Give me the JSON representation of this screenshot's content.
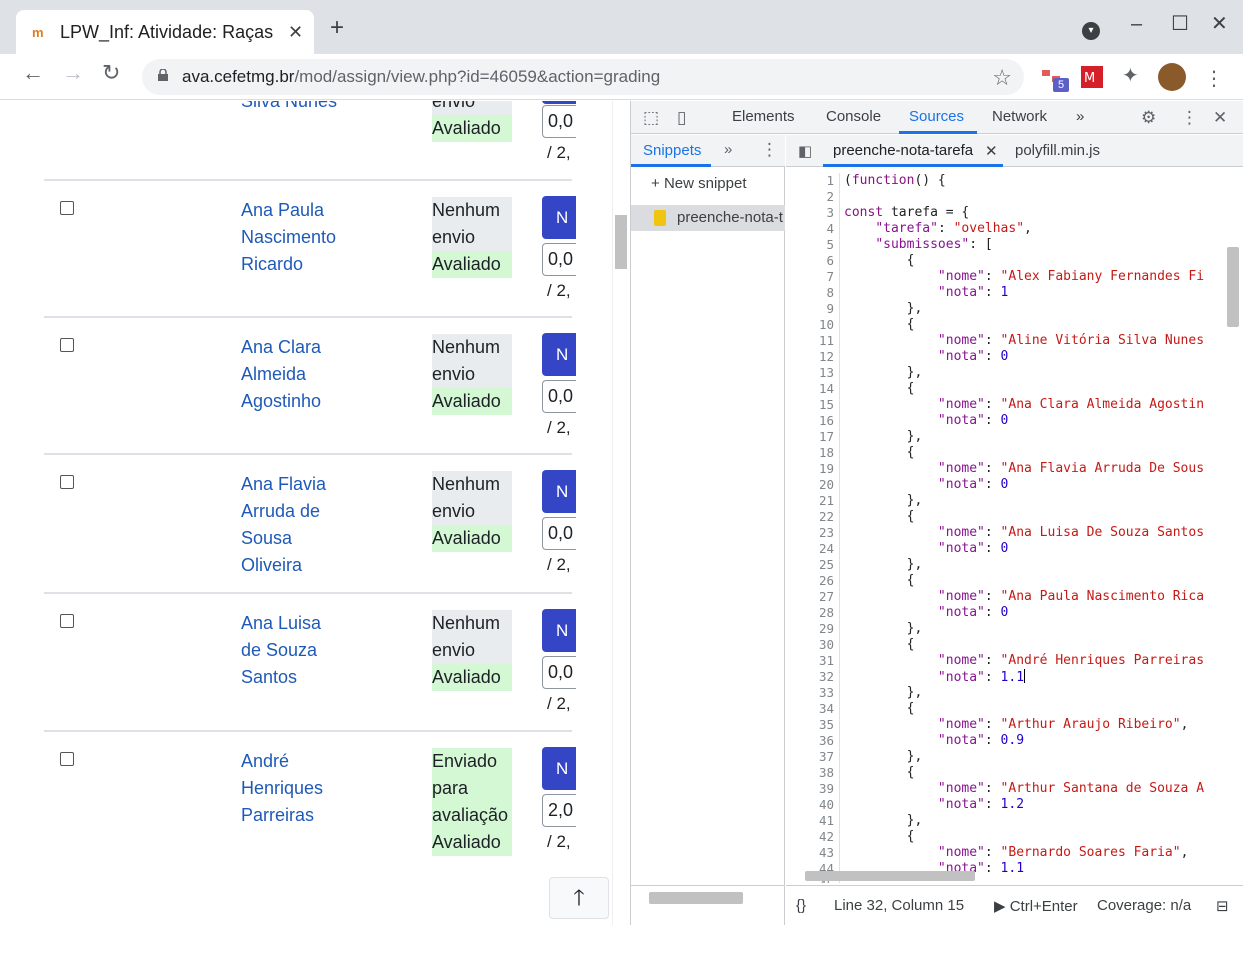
{
  "browser": {
    "tab_title": "LPW_Inf: Atividade: Raças",
    "new_tab": "+",
    "url_host": "ava.cefetmg.br",
    "url_path": "/mod/assign/view.php?id=46059&action=grading",
    "ext_badge": "5"
  },
  "page": {
    "rows": [
      {
        "name_lines": [
          "Silva Nunes"
        ],
        "status_lines": [
          "envio"
        ],
        "status_ok": "Avaliado",
        "grade": "0,0",
        "max": "/ 2,"
      },
      {
        "name_lines": [
          "Ana Paula",
          "Nascimento",
          "Ricardo"
        ],
        "status_lines": [
          "Nenhum",
          "envio"
        ],
        "status_ok": "Avaliado",
        "btn": "N",
        "grade": "0,0",
        "max": "/ 2,"
      },
      {
        "name_lines": [
          "Ana Clara",
          "Almeida",
          "Agostinho"
        ],
        "status_lines": [
          "Nenhum",
          "envio"
        ],
        "status_ok": "Avaliado",
        "btn": "N",
        "grade": "0,0",
        "max": "/ 2,"
      },
      {
        "name_lines": [
          "Ana Flavia",
          "Arruda de",
          "Sousa",
          "Oliveira"
        ],
        "status_lines": [
          "Nenhum",
          "envio"
        ],
        "status_ok": "Avaliado",
        "btn": "N",
        "grade": "0,0",
        "max": "/ 2,"
      },
      {
        "name_lines": [
          "Ana Luisa",
          "de Souza",
          "Santos"
        ],
        "status_lines": [
          "Nenhum",
          "envio"
        ],
        "status_ok": "Avaliado",
        "btn": "N",
        "grade": "0,0",
        "max": "/ 2,"
      },
      {
        "name_lines": [
          "André",
          "Henriques",
          "Parreiras"
        ],
        "status_lines": [
          "Enviado",
          "para",
          "avaliação"
        ],
        "status_ok": "Avaliado",
        "btn": "N",
        "grade": "2,0",
        "max": "/ 2,"
      }
    ],
    "to_top": "🡑"
  },
  "devtools": {
    "tabs": [
      "Elements",
      "Console",
      "Sources",
      "Network"
    ],
    "active_tab": "Sources",
    "more": "»",
    "nav_label": "Snippets",
    "new_snippet": "New snippet",
    "snippet_name": "preenche-nota-t",
    "editor_tabs": [
      "preenche-nota-tarefa",
      "polyfill.min.js"
    ],
    "status_position": "Line 32, Column 15",
    "status_run": "Ctrl+Enter",
    "status_coverage": "Coverage: n/a",
    "code_lines": [
      "(function() {",
      "",
      "const tarefa = {",
      "    \"tarefa\": \"ovelhas\",",
      "    \"submissoes\": [",
      "        {",
      "            \"nome\": \"Alex Fabiany Fernandes Fi",
      "            \"nota\": 1",
      "        },",
      "        {",
      "            \"nome\": \"Aline Vitória Silva Nunes",
      "            \"nota\": 0",
      "        },",
      "        {",
      "            \"nome\": \"Ana Clara Almeida Agostin",
      "            \"nota\": 0",
      "        },",
      "        {",
      "            \"nome\": \"Ana Flavia Arruda De Sous",
      "            \"nota\": 0",
      "        },",
      "        {",
      "            \"nome\": \"Ana Luisa De Souza Santos",
      "            \"nota\": 0",
      "        },",
      "        {",
      "            \"nome\": \"Ana Paula Nascimento Rica",
      "            \"nota\": 0",
      "        },",
      "        {",
      "            \"nome\": \"André Henriques Parreiras",
      "            \"nota\": 1.1",
      "        },",
      "        {",
      "            \"nome\": \"Arthur Araujo Ribeiro\",",
      "            \"nota\": 0.9",
      "        },",
      "        {",
      "            \"nome\": \"Arthur Santana de Souza A",
      "            \"nota\": 1.2",
      "        },",
      "        {",
      "            \"nome\": \"Bernardo Soares Faria\",",
      "            \"nota\": 1.1",
      "45"
    ]
  }
}
